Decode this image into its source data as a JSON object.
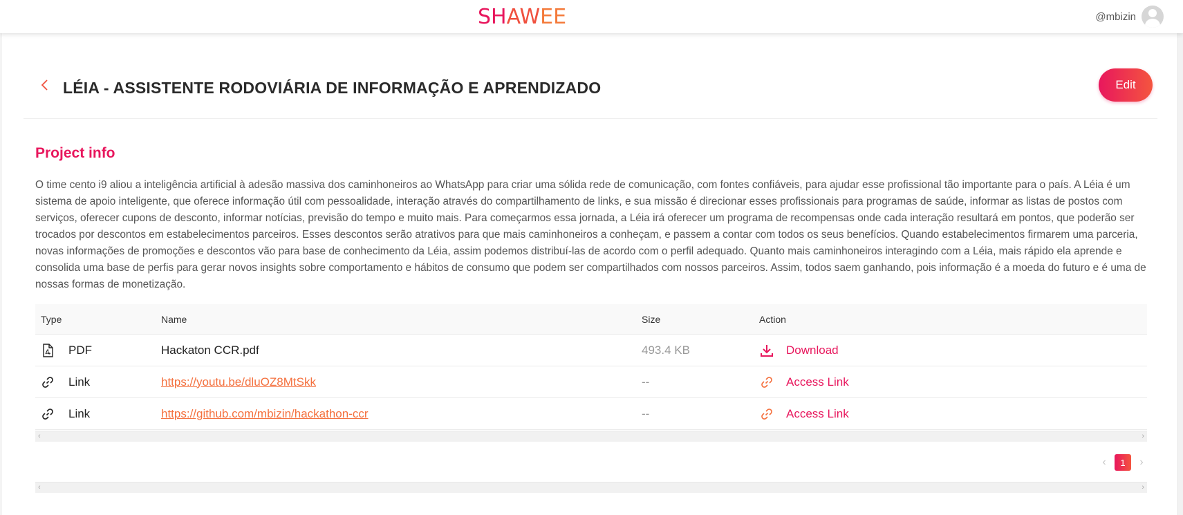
{
  "navbar": {
    "logo_part1": "SH",
    "logo_part2": "AW",
    "logo_part3": "EE",
    "username": "@mbizin"
  },
  "header": {
    "title": "LÉIA - ASSISTENTE RODOVIÁRIA DE INFORMAÇÃO E APRENDIZADO",
    "edit_label": "Edit"
  },
  "project": {
    "section_title": "Project info",
    "description": "O time cento i9 aliou a inteligência artificial à adesão massiva dos caminhoneiros ao WhatsApp para criar uma sólida rede de comunicação, com fontes confiáveis, para ajudar esse profissional tão importante para o país. A Léia é um sistema de apoio inteligente, que oferece informação útil com pessoalidade, interação através do compartilhamento de links, e sua missão é direcionar esses profissionais para programas de saúde, informar as listas de postos com serviços, oferecer cupons de desconto, informar notícias, previsão do tempo e muito mais. Para começarmos essa jornada, a Léia irá oferecer um programa de recompensas onde cada interação resultará em pontos, que poderão ser trocados por descontos em estabelecimentos parceiros. Esses descontos serão atrativos para que mais caminhoneiros a conheçam, e passem a contar com todos os seus benefícios. Quando estabelecimentos firmarem uma parceria, novas informações de promoções e descontos vão para base de conhecimento da Léia, assim podemos distribuí-las de acordo com o perfil adequado. Quanto mais caminhoneiros interagindo com a Léia, mais rápido ela aprende e consolida uma base de perfis para gerar novos insights sobre comportamento e hábitos de consumo que podem ser compartilhados com nossos parceiros. Assim, todos saem ganhando, pois informação é a moeda do futuro e é uma de nossas formas de monetização."
  },
  "table": {
    "columns": [
      "Type",
      "Name",
      "Size",
      "Action"
    ],
    "rows": [
      {
        "type": "PDF",
        "type_icon": "pdf-file-icon",
        "name": "Hackaton CCR.pdf",
        "size": "493.4 KB",
        "action": "Download",
        "action_icon": "download-icon"
      },
      {
        "type": "Link",
        "type_icon": "link-icon",
        "name": "https://youtu.be/dluOZ8MtSkk",
        "size": "--",
        "action": "Access Link",
        "action_icon": "link-icon"
      },
      {
        "type": "Link",
        "type_icon": "link-icon",
        "name": "https://github.com/mbizin/hackathon-ccr",
        "size": "--",
        "action": "Access Link",
        "action_icon": "link-icon"
      }
    ]
  },
  "pagination": {
    "current_page": "1"
  },
  "colors": {
    "brand_pink": "#e8175d",
    "brand_orange": "#f4703e"
  }
}
